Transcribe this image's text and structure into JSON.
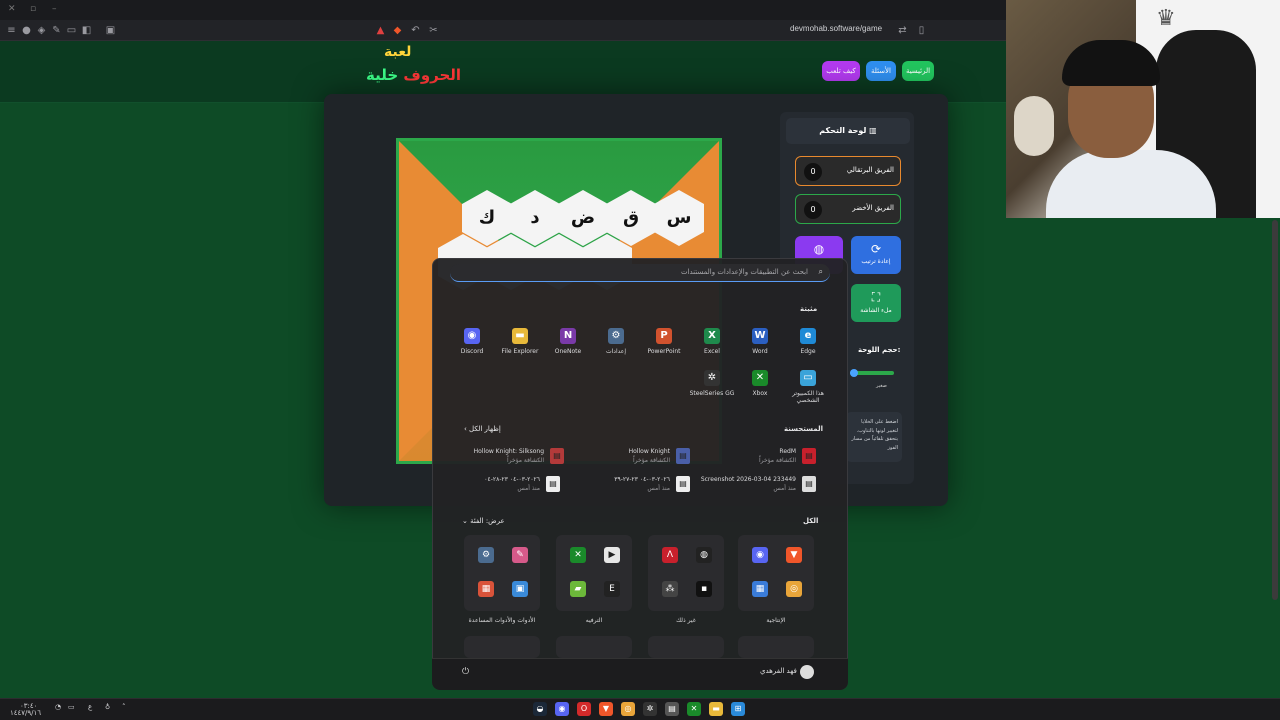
{
  "browser": {
    "url": "devmohab.software/game"
  },
  "game": {
    "logo_line1": "لعبة",
    "logo_word1": "خلية",
    "logo_word2": "الحروف",
    "nav": {
      "home": "الرئيسية",
      "questions": "الأسئلة",
      "how_to_play": "كيف تلعب"
    },
    "board_letters_row1": [
      "س",
      "ق",
      "ض",
      "د",
      "ك"
    ],
    "dashboard_title": "لوحة التحكم",
    "teams": [
      {
        "name": "الفريق البرتقالي",
        "score": "0",
        "color": "#e8892e"
      },
      {
        "name": "الفريق الأخضر",
        "score": "0",
        "color": "#2ca84a"
      }
    ],
    "buttons": {
      "reshuffle": "إعادة ترتيب",
      "fullscreen": "ملء الشاشة"
    },
    "size_label": "حجم اللوحة:",
    "size_value": "صغير",
    "hint_text": "اضغط على الخلايا لتغيير لونها بالتناوب. يتحقق تلقائياً من مسار الفوز"
  },
  "start_menu": {
    "search_placeholder": "ابحث عن التطبيقات والإعدادات والمستندات",
    "pinned_title": "مثبتة",
    "pinned": [
      {
        "label": "Edge",
        "icon": "edge-icon",
        "color": "#1f8ad6",
        "glyph": "e"
      },
      {
        "label": "Word",
        "icon": "word-icon",
        "color": "#2b5fc1",
        "glyph": "W"
      },
      {
        "label": "Excel",
        "icon": "excel-icon",
        "color": "#1f8a4c",
        "glyph": "X"
      },
      {
        "label": "PowerPoint",
        "icon": "powerpoint-icon",
        "color": "#d1522e",
        "glyph": "P"
      },
      {
        "label": "إعدادات",
        "icon": "settings-icon",
        "color": "#4b6b8f",
        "glyph": "⚙"
      },
      {
        "label": "OneNote",
        "icon": "onenote-icon",
        "color": "#7a3aa8",
        "glyph": "N"
      },
      {
        "label": "File Explorer",
        "icon": "folder-icon",
        "color": "#e8b93a",
        "glyph": "▬"
      },
      {
        "label": "Discord",
        "icon": "discord-icon",
        "color": "#5865f2",
        "glyph": "◉"
      }
    ],
    "pinned_row2": [
      {
        "label": "هذا الكمبيوتر الشخصي",
        "icon": "computer-icon",
        "color": "#3aa3d9",
        "glyph": "▭"
      },
      {
        "label": "Xbox",
        "icon": "xbox-icon",
        "color": "#1a8a2a",
        "glyph": "✕"
      },
      {
        "label": "SteelSeries GG",
        "icon": "steelseries-icon",
        "color": "#333",
        "glyph": "✲"
      }
    ],
    "recommended_title": "المستحسنة",
    "show_all": "إظهار الكل",
    "recommended": [
      {
        "title": "RedM",
        "sub": "الكشافة مؤخراً",
        "icon": "redm-icon",
        "color": "#c8202c"
      },
      {
        "title": "Hollow Knight",
        "sub": "الكشافة مؤخراً",
        "icon": "hollow-knight-icon",
        "color": "#4a5fa8"
      },
      {
        "title": "Hollow Knight: Silksong",
        "sub": "الكشافة مؤخراً",
        "icon": "silksong-icon",
        "color": "#b33a3a"
      },
      {
        "title": "Screenshot 2026-03-04 233449",
        "sub": "منذ أمس",
        "icon": "image-file-icon",
        "color": "#ddd"
      },
      {
        "title": "٢٠٢٦-٠٣-٠٤ ٢٣-٢٧-٣٩",
        "sub": "منذ أمس",
        "icon": "video-file-icon",
        "color": "#eee"
      },
      {
        "title": "٢٠٢٦-٠٣-٠٤ ٢٣-٢٨-٠٤",
        "sub": "منذ أمس",
        "icon": "video-file-icon",
        "color": "#eee"
      }
    ],
    "all_title": "الكل",
    "view_by": "عرض: الفئة",
    "groups": [
      {
        "label": "الإنتاجية",
        "icons": [
          {
            "icon": "brave-icon",
            "color": "#f0562a",
            "glyph": "▼"
          },
          {
            "icon": "discord-icon",
            "color": "#5865f2",
            "glyph": "◉"
          },
          {
            "icon": "chrome-icon",
            "color": "#e9a53a",
            "glyph": "◎"
          },
          {
            "icon": "widgets-icon",
            "color": "#3a7cd9",
            "glyph": "▦"
          }
        ]
      },
      {
        "label": "غير ذلك",
        "icons": [
          {
            "icon": "obs-icon",
            "color": "#222",
            "glyph": "◍"
          },
          {
            "icon": "affinity-icon",
            "color": "#c8202c",
            "glyph": "Λ"
          },
          {
            "icon": "black-app-icon",
            "color": "#111",
            "glyph": "▪"
          },
          {
            "icon": "apps-icon",
            "color": "#444",
            "glyph": "⁂"
          }
        ]
      },
      {
        "label": "الترفيه",
        "icons": [
          {
            "icon": "media-player-icon",
            "color": "#e7e7e7",
            "glyph": "▶"
          },
          {
            "icon": "xbox-icon",
            "color": "#1a8a2a",
            "glyph": "✕"
          },
          {
            "icon": "epic-games-icon",
            "color": "#222",
            "glyph": "E"
          },
          {
            "icon": "nvidia-icon",
            "color": "#6cb83a",
            "glyph": "▰"
          }
        ]
      },
      {
        "label": "الأدوات والأدوات المساعدة",
        "icons": [
          {
            "icon": "paint-icon",
            "color": "#d65a8a",
            "glyph": "✎"
          },
          {
            "icon": "settings-icon",
            "color": "#4b6b8f",
            "glyph": "⚙"
          },
          {
            "icon": "store-icon",
            "color": "#3a8ad9",
            "glyph": "▣"
          },
          {
            "icon": "tiles-icon",
            "color": "#d9533a",
            "glyph": "▦"
          }
        ]
      }
    ],
    "user_name": "فهد الفرهدي"
  },
  "taskbar": {
    "time": "٠٣:٤٠",
    "date": "١٤٤٧/٩/١٦",
    "lang": "ع",
    "apps": [
      {
        "icon": "steam-icon",
        "color": "#1b2838",
        "glyph": "◒"
      },
      {
        "icon": "discord-icon",
        "color": "#5865f2",
        "glyph": "◉"
      },
      {
        "icon": "opera-icon",
        "color": "#d32a2a",
        "glyph": "O"
      },
      {
        "icon": "brave-icon",
        "color": "#f0562a",
        "glyph": "▼"
      },
      {
        "icon": "chrome-icon",
        "color": "#e9a53a",
        "glyph": "◎"
      },
      {
        "icon": "steelseries-icon",
        "color": "#333",
        "glyph": "✲"
      },
      {
        "icon": "calendar-icon",
        "color": "#555",
        "glyph": "▤"
      },
      {
        "icon": "xbox-icon",
        "color": "#1a8a2a",
        "glyph": "✕"
      },
      {
        "icon": "folder-icon",
        "color": "#e8b93a",
        "glyph": "▬"
      },
      {
        "icon": "start-icon",
        "color": "#2a8ad9",
        "glyph": "⊞"
      }
    ]
  }
}
